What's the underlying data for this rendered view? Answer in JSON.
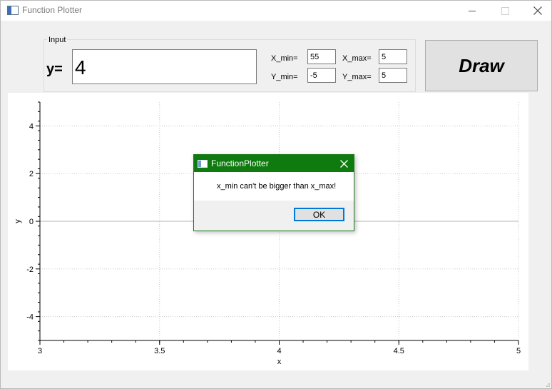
{
  "window": {
    "title": "Function Plotter",
    "icon": "app-window-icon"
  },
  "input": {
    "group_title": "Input",
    "y_label": "y=",
    "expression": "4",
    "x_min_label": "X_min=",
    "x_min_value": "55",
    "x_max_label": "X_max=",
    "x_max_value": "5",
    "y_min_label": "Y_min=",
    "y_min_value": "-5",
    "y_max_label": "Y_max=",
    "y_max_value": "5",
    "draw_label": "Draw"
  },
  "chart_data": {
    "type": "line",
    "xlabel": "x",
    "ylabel": "y",
    "xlim": [
      3,
      5
    ],
    "ylim": [
      -5,
      5
    ],
    "x_ticks": [
      3,
      3.5,
      4,
      4.5,
      5
    ],
    "x_tick_labels": [
      "3",
      "3.5",
      "4",
      "4.5",
      "5"
    ],
    "y_ticks": [
      4,
      2,
      0,
      -2,
      -4
    ],
    "y_tick_labels": [
      "4",
      "2",
      "0",
      "-2",
      "-4"
    ],
    "grid": true,
    "series": []
  },
  "dialog": {
    "title": "FunctionPlotter",
    "message": "x_min can't be bigger than x_max!",
    "ok_label": "OK",
    "accent": "#0f7b0f"
  }
}
